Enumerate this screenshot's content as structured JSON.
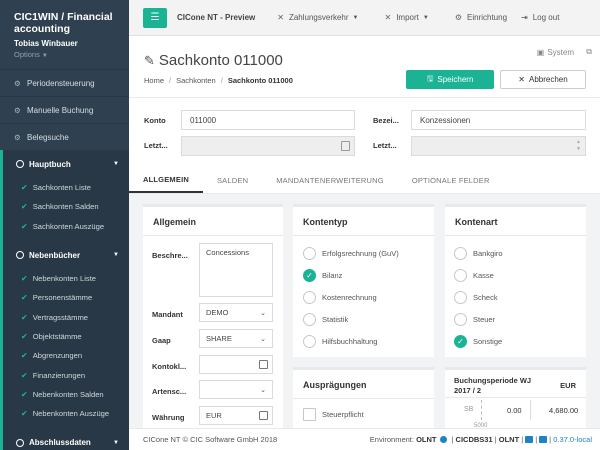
{
  "sidebar": {
    "brand": "CIC1WIN / Financial accounting",
    "user": "Tobias Winbauer",
    "options": "Options",
    "items": [
      {
        "label": "Periodensteuerung",
        "icon": "cogs-icon"
      },
      {
        "label": "Manuelle Buchung",
        "icon": "cogs-icon"
      },
      {
        "label": "Belegsuche",
        "icon": "cogs-icon"
      }
    ],
    "hauptbuch": {
      "label": "Hauptbuch",
      "subs": [
        "Sachkonten Liste",
        "Sachkonten Salden",
        "Sachkonten Auszüge"
      ]
    },
    "nebenbuecher": {
      "label": "Nebenbücher",
      "subs": [
        "Nebenkonten Liste",
        "Personenstämme",
        "Vertragsstämme",
        "Objektstämme",
        "Abgrenzungen",
        "Finanzierungen",
        "Nebenkonten Salden",
        "Nebenkonten Auszüge"
      ]
    },
    "abschlussdaten": "Abschlussdaten"
  },
  "topbar": {
    "app": "CICone NT - Preview",
    "nav1": "Zahlungsverkehr",
    "nav2": "Import",
    "nav3": "Einrichtung",
    "logout": "Log out"
  },
  "page": {
    "title": "Sachkonto 011000",
    "system": "System",
    "crumbs": [
      "Home",
      "Sachkonten",
      "Sachkonto 011000"
    ],
    "save": "Speichern",
    "cancel": "Abbrechen"
  },
  "form": {
    "konto_label": "Konto",
    "konto_value": "011000",
    "bez_label": "Bezei...",
    "bez_value": "Konzessionen",
    "letzt1_label": "Letzt...",
    "letzt2_label": "Letzt..."
  },
  "tabs": [
    "ALLGEMEIN",
    "SALDEN",
    "MANDANTENERWEITERUNG",
    "OPTIONALE FELDER"
  ],
  "allgemein": {
    "title": "Allgemein",
    "beschreibung_label": "Beschre...",
    "beschreibung_value": "Concessions",
    "mandant_label": "Mandant",
    "mandant_value": "DEMO",
    "gaap_label": "Gaap",
    "gaap_value": "SHARE",
    "kontokl_label": "Kontokl...",
    "artensc_label": "Artensc...",
    "waehrung_label": "Währung",
    "waehrung_value": "EUR"
  },
  "kontentyp": {
    "title": "Kontentyp",
    "options": [
      "Erfolgsrechnung (GuV)",
      "Bilanz",
      "Kostenrechnung",
      "Statistik",
      "Hilfsbuchhaltung"
    ],
    "selected": 1
  },
  "kontenart": {
    "title": "Kontenart",
    "options": [
      "Bankgiro",
      "Kasse",
      "Scheck",
      "Steuer",
      "Sonstige"
    ],
    "selected": 4
  },
  "auspraegungen": {
    "title": "Ausprägungen",
    "steuerpflicht": "Steuerpflicht"
  },
  "buchungsperiode": {
    "title": "Buchungsperiode WJ 2017 / 2",
    "currency": "EUR",
    "sb_label": "SB",
    "val1": "0.00",
    "val2": "4,680.00",
    "axis": "5000"
  },
  "footer": {
    "copyright": "CICone NT © CIC Software GmbH 2018",
    "env_label": "Environment:",
    "env": "OLNT",
    "db": "CICDBS31",
    "olnt2": "OLNT",
    "version": "0.37.0-local"
  }
}
